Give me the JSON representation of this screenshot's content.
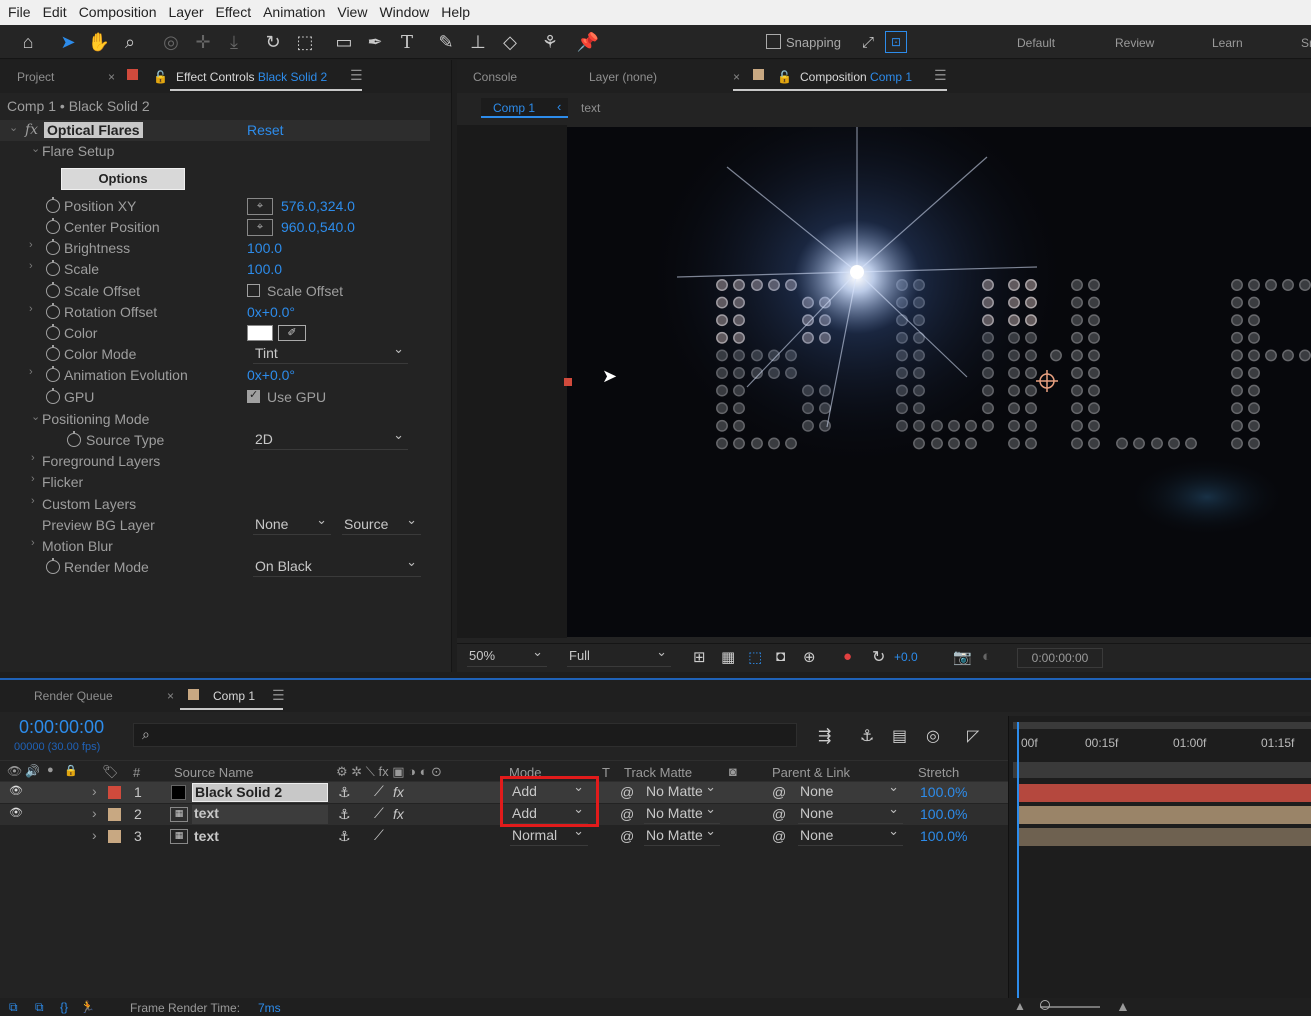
{
  "menu": [
    "File",
    "Edit",
    "Composition",
    "Layer",
    "Effect",
    "Animation",
    "View",
    "Window",
    "Help"
  ],
  "toolbar": {
    "snapping_label": "Snapping",
    "workspaces": [
      "Default",
      "Review",
      "Learn",
      "Sr"
    ]
  },
  "left_panel": {
    "tabs": {
      "project": "Project",
      "effect_controls": "Effect Controls",
      "effect_controls_layer": "Black Solid 2"
    },
    "breadcrumb": "Comp 1 • Black Solid 2",
    "effect": {
      "fx": "fx",
      "name": "Optical Flares",
      "reset": "Reset"
    },
    "options_button": "Options",
    "rows": {
      "flare_setup": "Flare Setup",
      "position_xy": {
        "label": "Position XY",
        "value": "576.0,324.0"
      },
      "center_position": {
        "label": "Center Position",
        "value": "960.0,540.0"
      },
      "brightness": {
        "label": "Brightness",
        "value": "100.0"
      },
      "scale": {
        "label": "Scale",
        "value": "100.0"
      },
      "scale_offset": {
        "label": "Scale Offset",
        "checkbox": "Scale Offset"
      },
      "rotation_offset": {
        "label": "Rotation Offset",
        "value": "0x+0.0°"
      },
      "color": {
        "label": "Color"
      },
      "color_mode": {
        "label": "Color Mode",
        "value": "Tint"
      },
      "animation_evolution": {
        "label": "Animation Evolution",
        "value": "0x+0.0°"
      },
      "gpu": {
        "label": "GPU",
        "checkbox": "Use GPU"
      },
      "positioning_mode": "Positioning Mode",
      "source_type": {
        "label": "Source Type",
        "value": "2D"
      },
      "foreground_layers": "Foreground Layers",
      "flicker": "Flicker",
      "custom_layers": "Custom Layers",
      "preview_bg_layer": {
        "label": "Preview BG Layer",
        "value1": "None",
        "value2": "Source"
      },
      "motion_blur": "Motion Blur",
      "render_mode": {
        "label": "Render Mode",
        "value": "On Black"
      }
    }
  },
  "right_panel": {
    "tabs": {
      "console": "Console",
      "layer": "Layer (none)",
      "composition": "Composition",
      "composition_name": "Comp 1"
    },
    "breadcrumbs": {
      "comp": "Comp 1",
      "layer": "text"
    },
    "footer": {
      "zoom": "50%",
      "resolution": "Full",
      "exposure": "+0.0",
      "timecode": "0:00:00:00"
    }
  },
  "timeline": {
    "tabs": {
      "render_queue": "Render Queue",
      "comp": "Comp 1"
    },
    "current_time": "0:00:00:00",
    "frames": "00000 (30.00 fps)",
    "columns": {
      "num": "#",
      "source_name": "Source Name",
      "mode": "Mode",
      "t": "T",
      "track_matte": "Track Matte",
      "parent": "Parent & Link",
      "stretch": "Stretch"
    },
    "ruler": [
      "00f",
      "00:15f",
      "01:00f",
      "01:15f"
    ],
    "layers": [
      {
        "num": "1",
        "name": "Black Solid 2",
        "mode": "Add",
        "matte": "No Matte",
        "parent": "None",
        "stretch": "100.0%",
        "color": "#d04a3c"
      },
      {
        "num": "2",
        "name": "text",
        "mode": "Add",
        "matte": "No Matte",
        "parent": "None",
        "stretch": "100.0%",
        "color": "#c8a882"
      },
      {
        "num": "3",
        "name": "text",
        "mode": "Normal",
        "matte": "No Matte",
        "parent": "None",
        "stretch": "100.0%",
        "color": "#c8a882"
      }
    ]
  },
  "status": {
    "label": "Frame Render Time:",
    "value": "7ms"
  },
  "colors": {
    "accent": "#2d8ceb",
    "highlight": "#e11b1b",
    "solid_layer": "#d04a3c",
    "text_layer": "#c8a882"
  }
}
